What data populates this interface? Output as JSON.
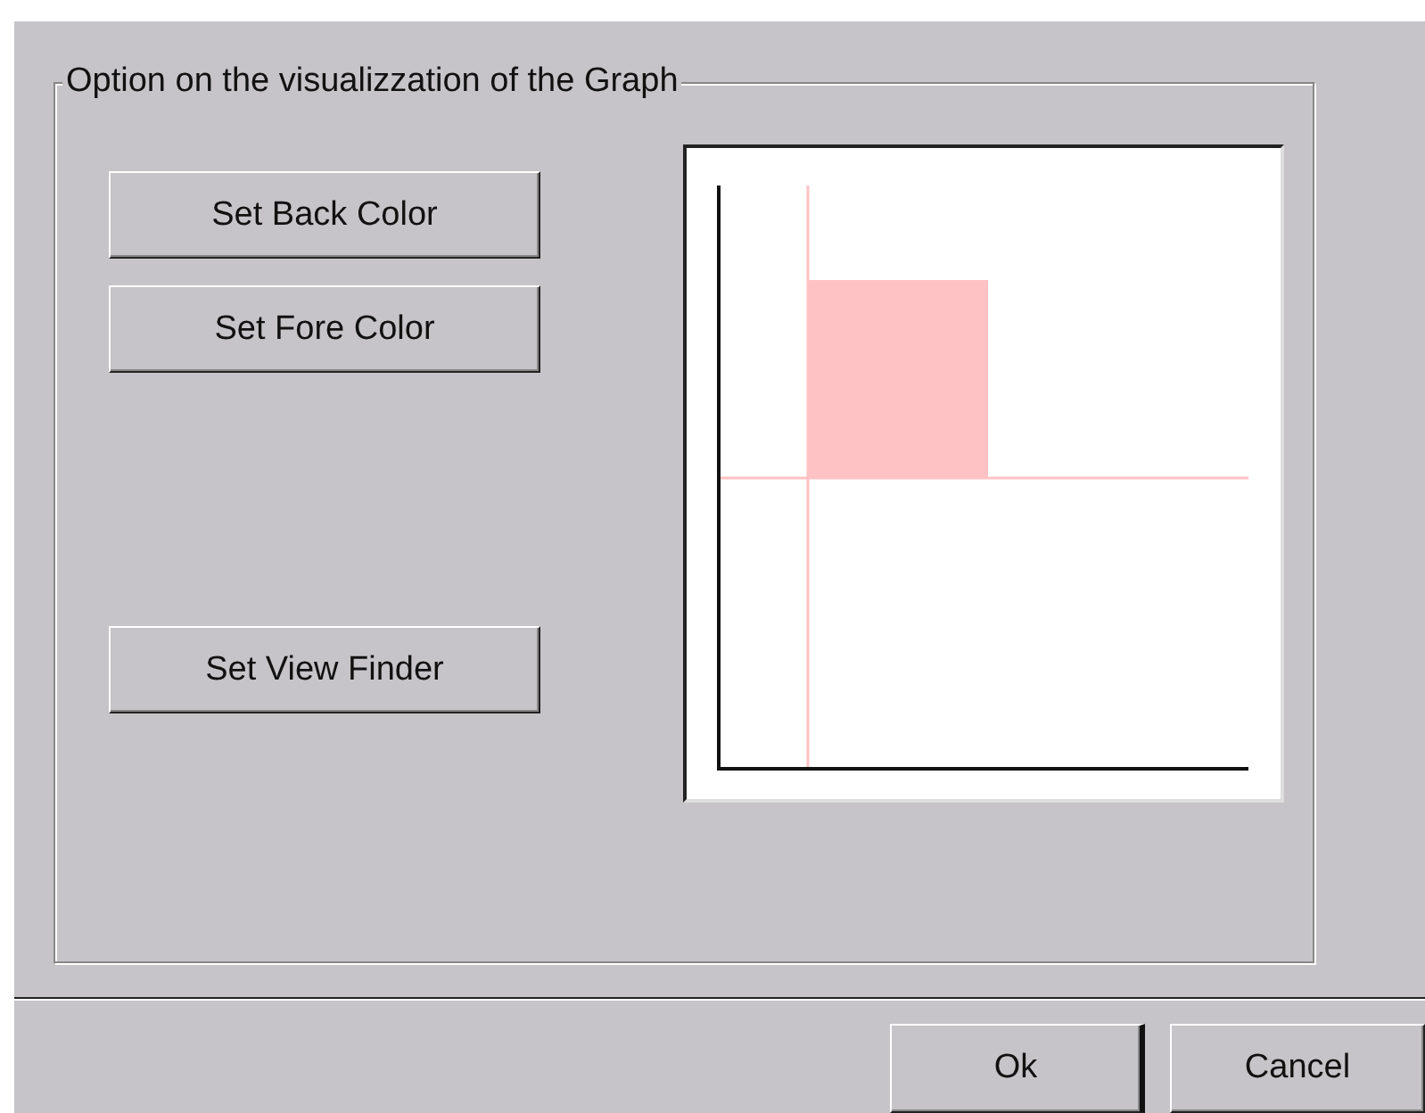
{
  "group": {
    "title": "Option on the visualizzation of the Graph"
  },
  "buttons": [
    "Set Back Color",
    "Set Fore Color",
    "Set View Finder"
  ],
  "dialog_buttons": [
    {
      "label": "Ok",
      "default": true
    },
    {
      "label": "Cancel",
      "default": false
    }
  ]
}
